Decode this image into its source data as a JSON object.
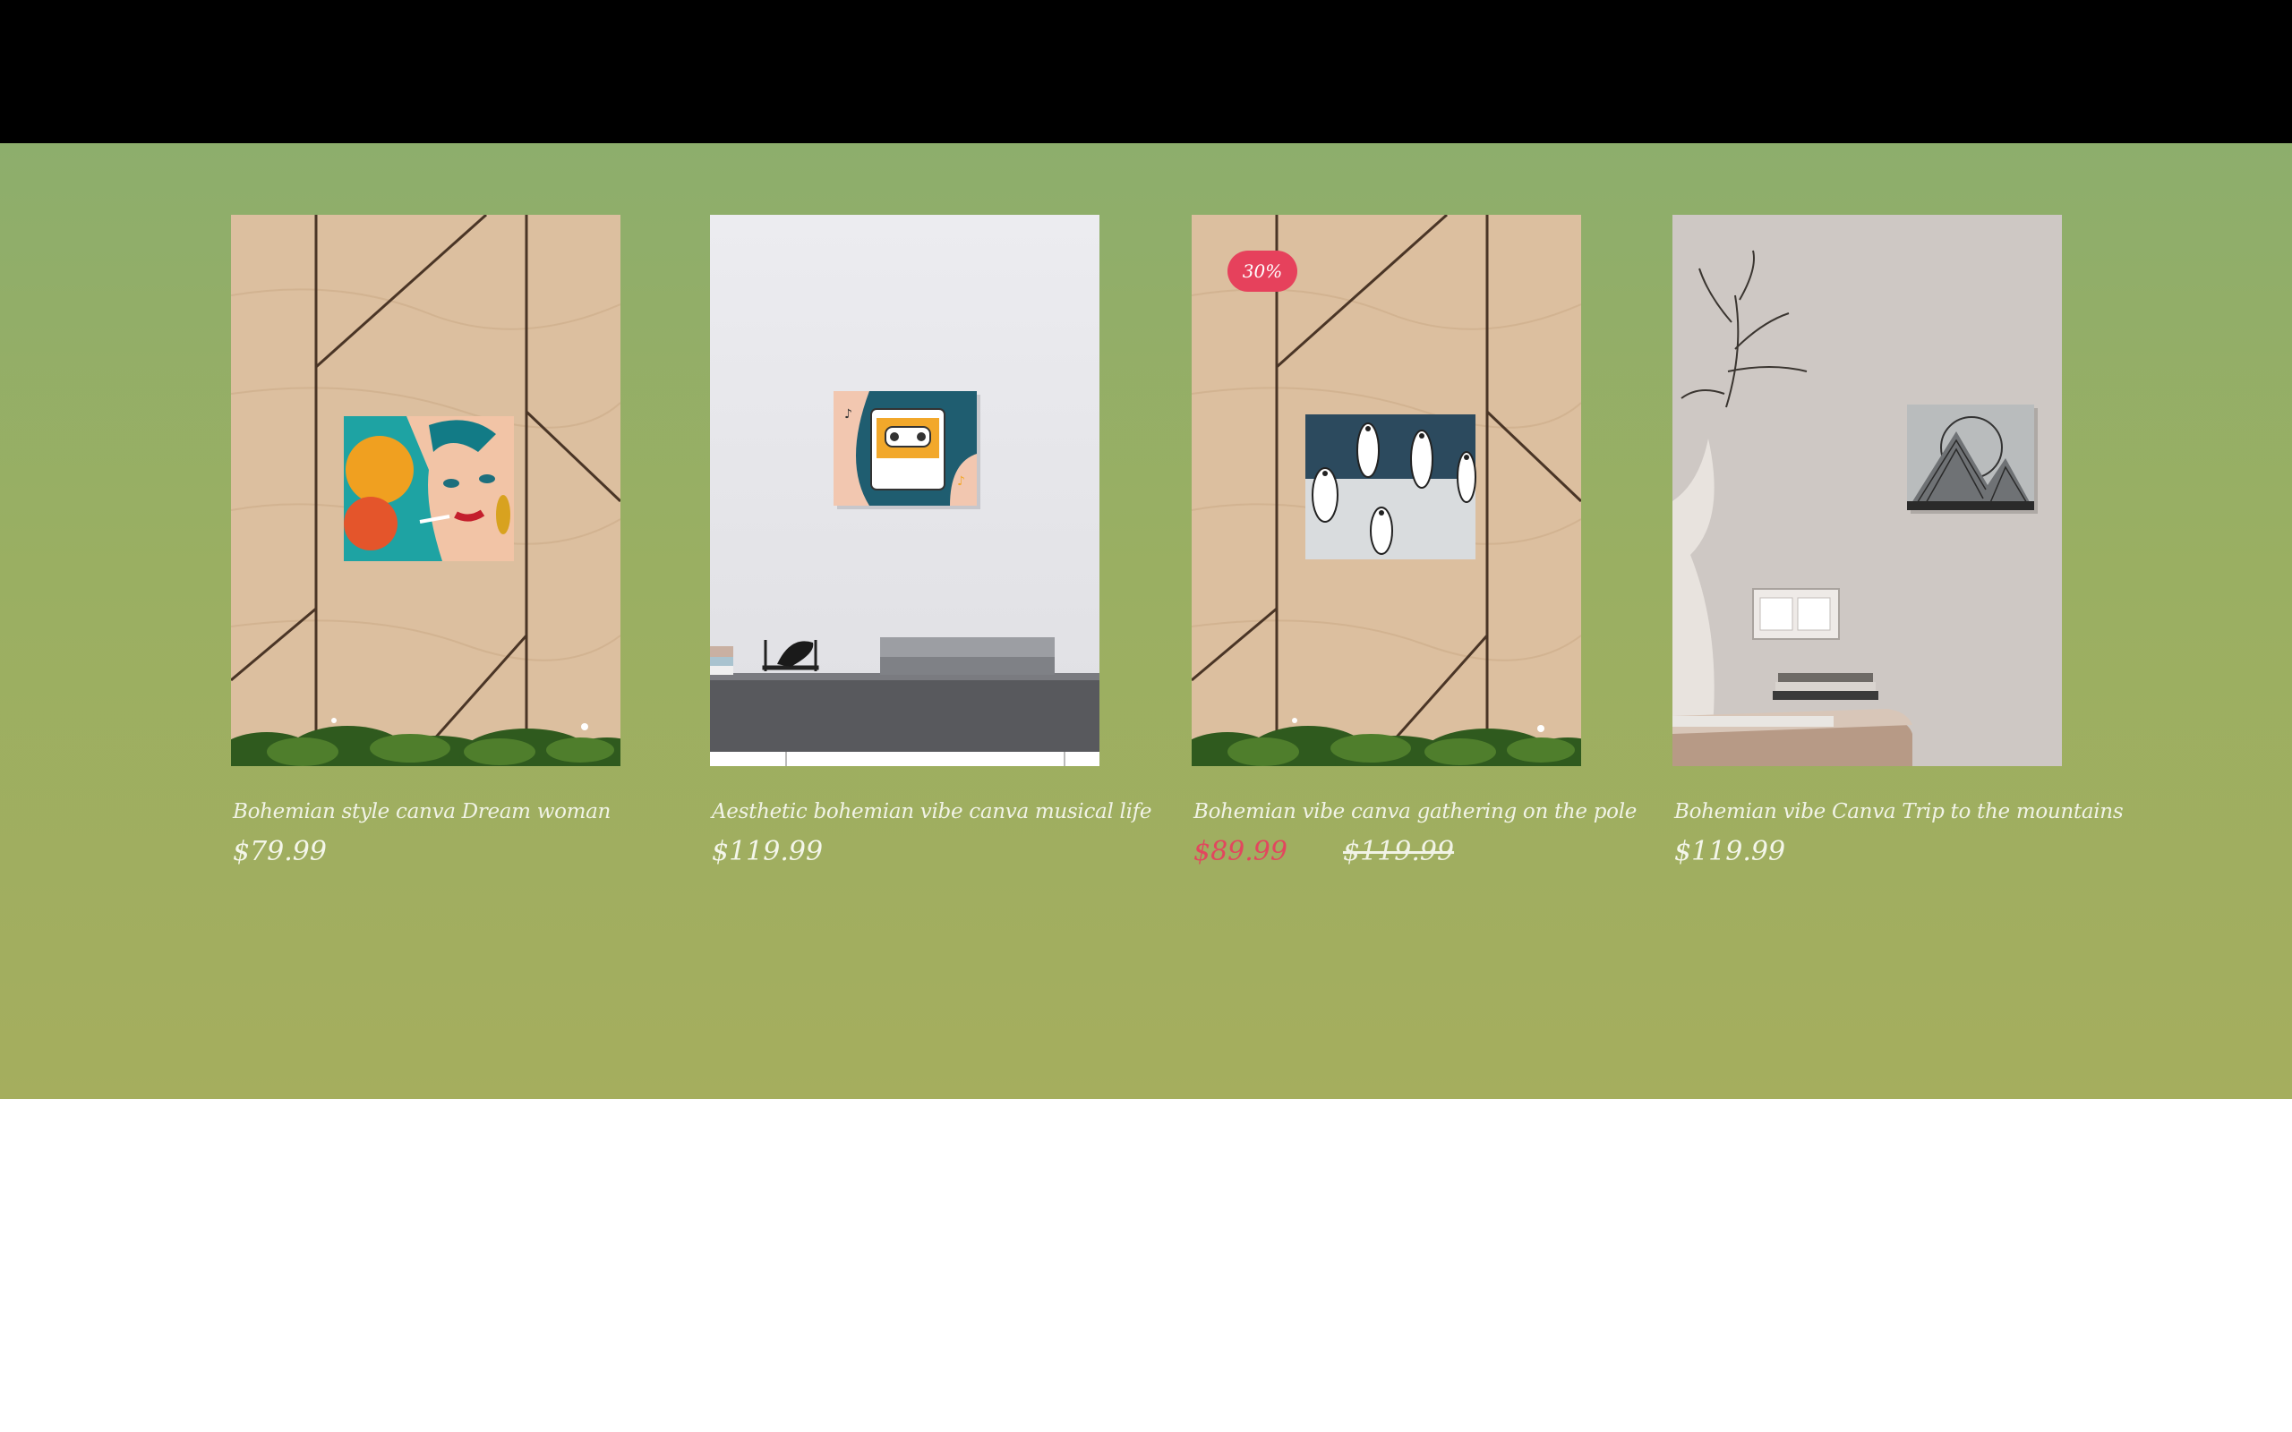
{
  "products": [
    {
      "title": "Bohemian style canva Dream woman",
      "price": "$79.99"
    },
    {
      "title": "Aesthetic bohemian vibe canva musical life",
      "price": "$119.99"
    },
    {
      "title": "Bohemian vibe canva gathering on the pole",
      "sale_price": "$89.99",
      "original_price": "$119.99",
      "badge": "30%"
    },
    {
      "title": "Bohemian vibe Canva Trip to the mountains",
      "price": "$119.99"
    }
  ],
  "colors": {
    "header": "#000000",
    "section_top": "#8dae6c",
    "section_bottom": "#a5ae5e",
    "sale": "#e2475e",
    "badge": "#e6415c"
  }
}
